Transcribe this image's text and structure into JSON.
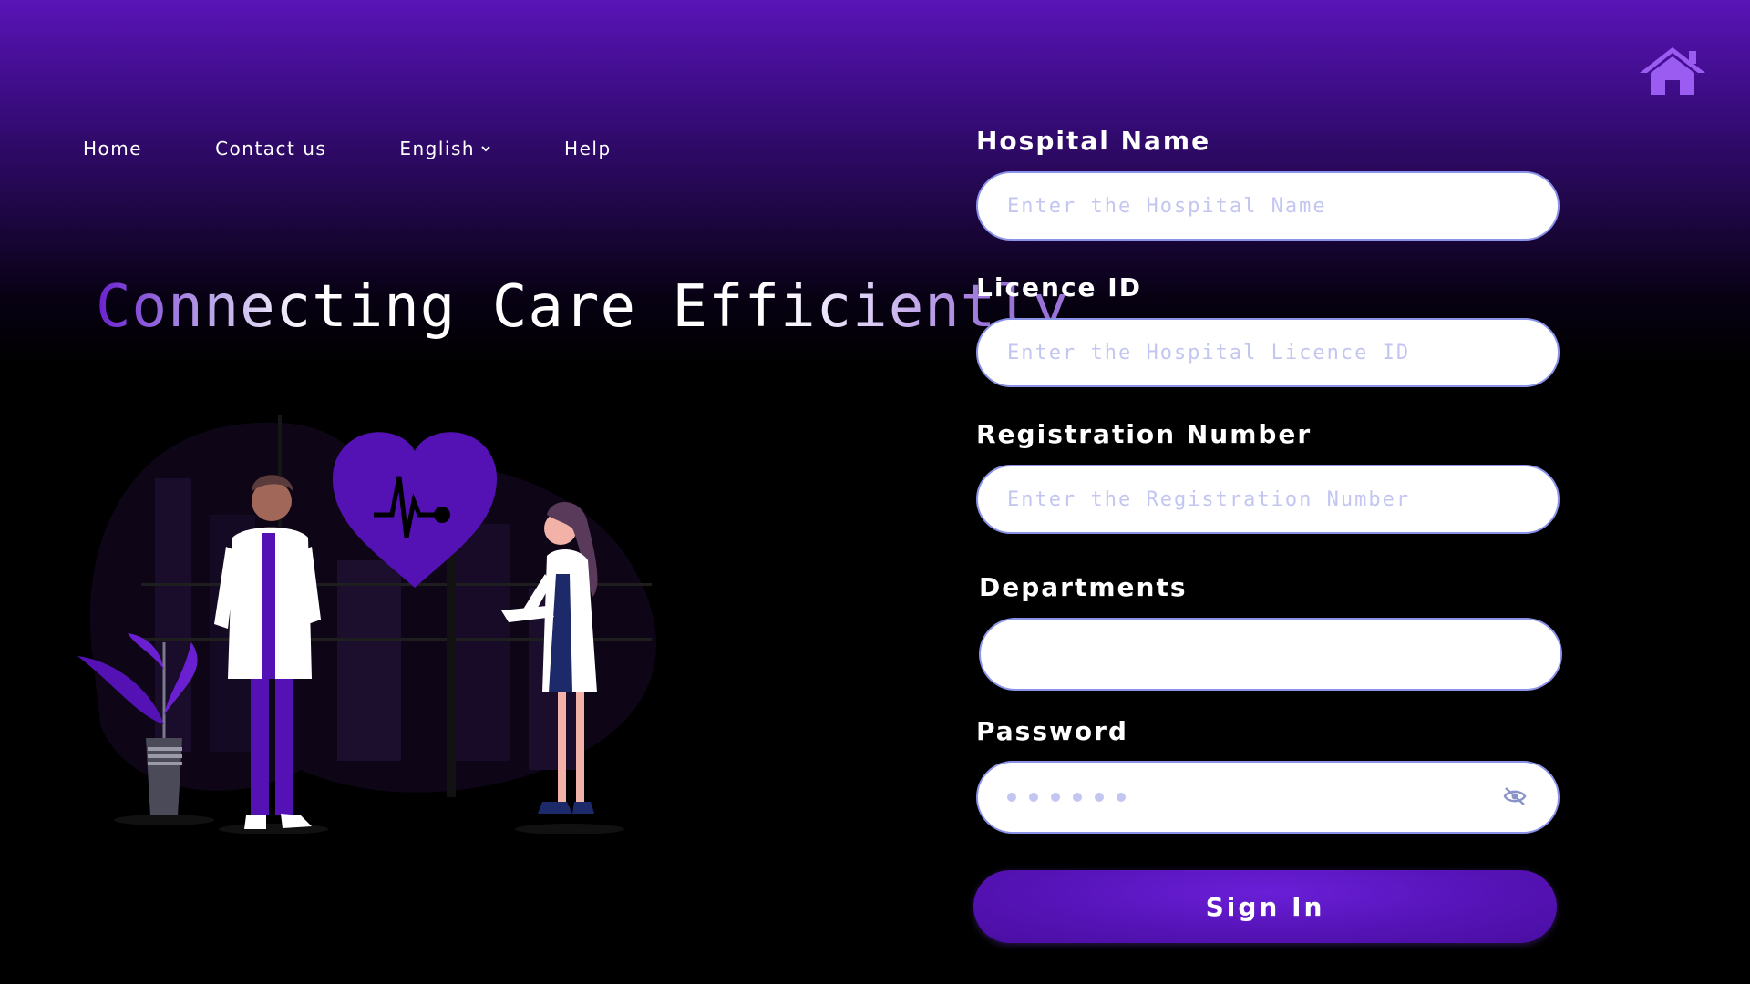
{
  "nav": {
    "home": "Home",
    "contact": "Contact us",
    "language": "English",
    "help": "Help"
  },
  "hero": {
    "headline": "Connecting Care Efficiently"
  },
  "form": {
    "hospital_name": {
      "label": "Hospital Name",
      "placeholder": "Enter the Hospital Name"
    },
    "licence_id": {
      "label": "Licence ID",
      "placeholder": "Enter the Hospital Licence ID"
    },
    "registration_number": {
      "label": "Registration Number",
      "placeholder": "Enter the Registration Number"
    },
    "departments": {
      "label": "Departments",
      "value": ""
    },
    "password": {
      "label": "Password",
      "masked_length": 6
    },
    "submit_label": "Sign In"
  },
  "icons": {
    "home": "home-icon",
    "chevron": "chevron-down-icon",
    "password_toggle": "eye-off-icon"
  },
  "colors": {
    "accent": "#5412b4",
    "home_icon": "#9b5cf2",
    "input_border": "#8a93e8",
    "placeholder": "#c3c6f0"
  }
}
